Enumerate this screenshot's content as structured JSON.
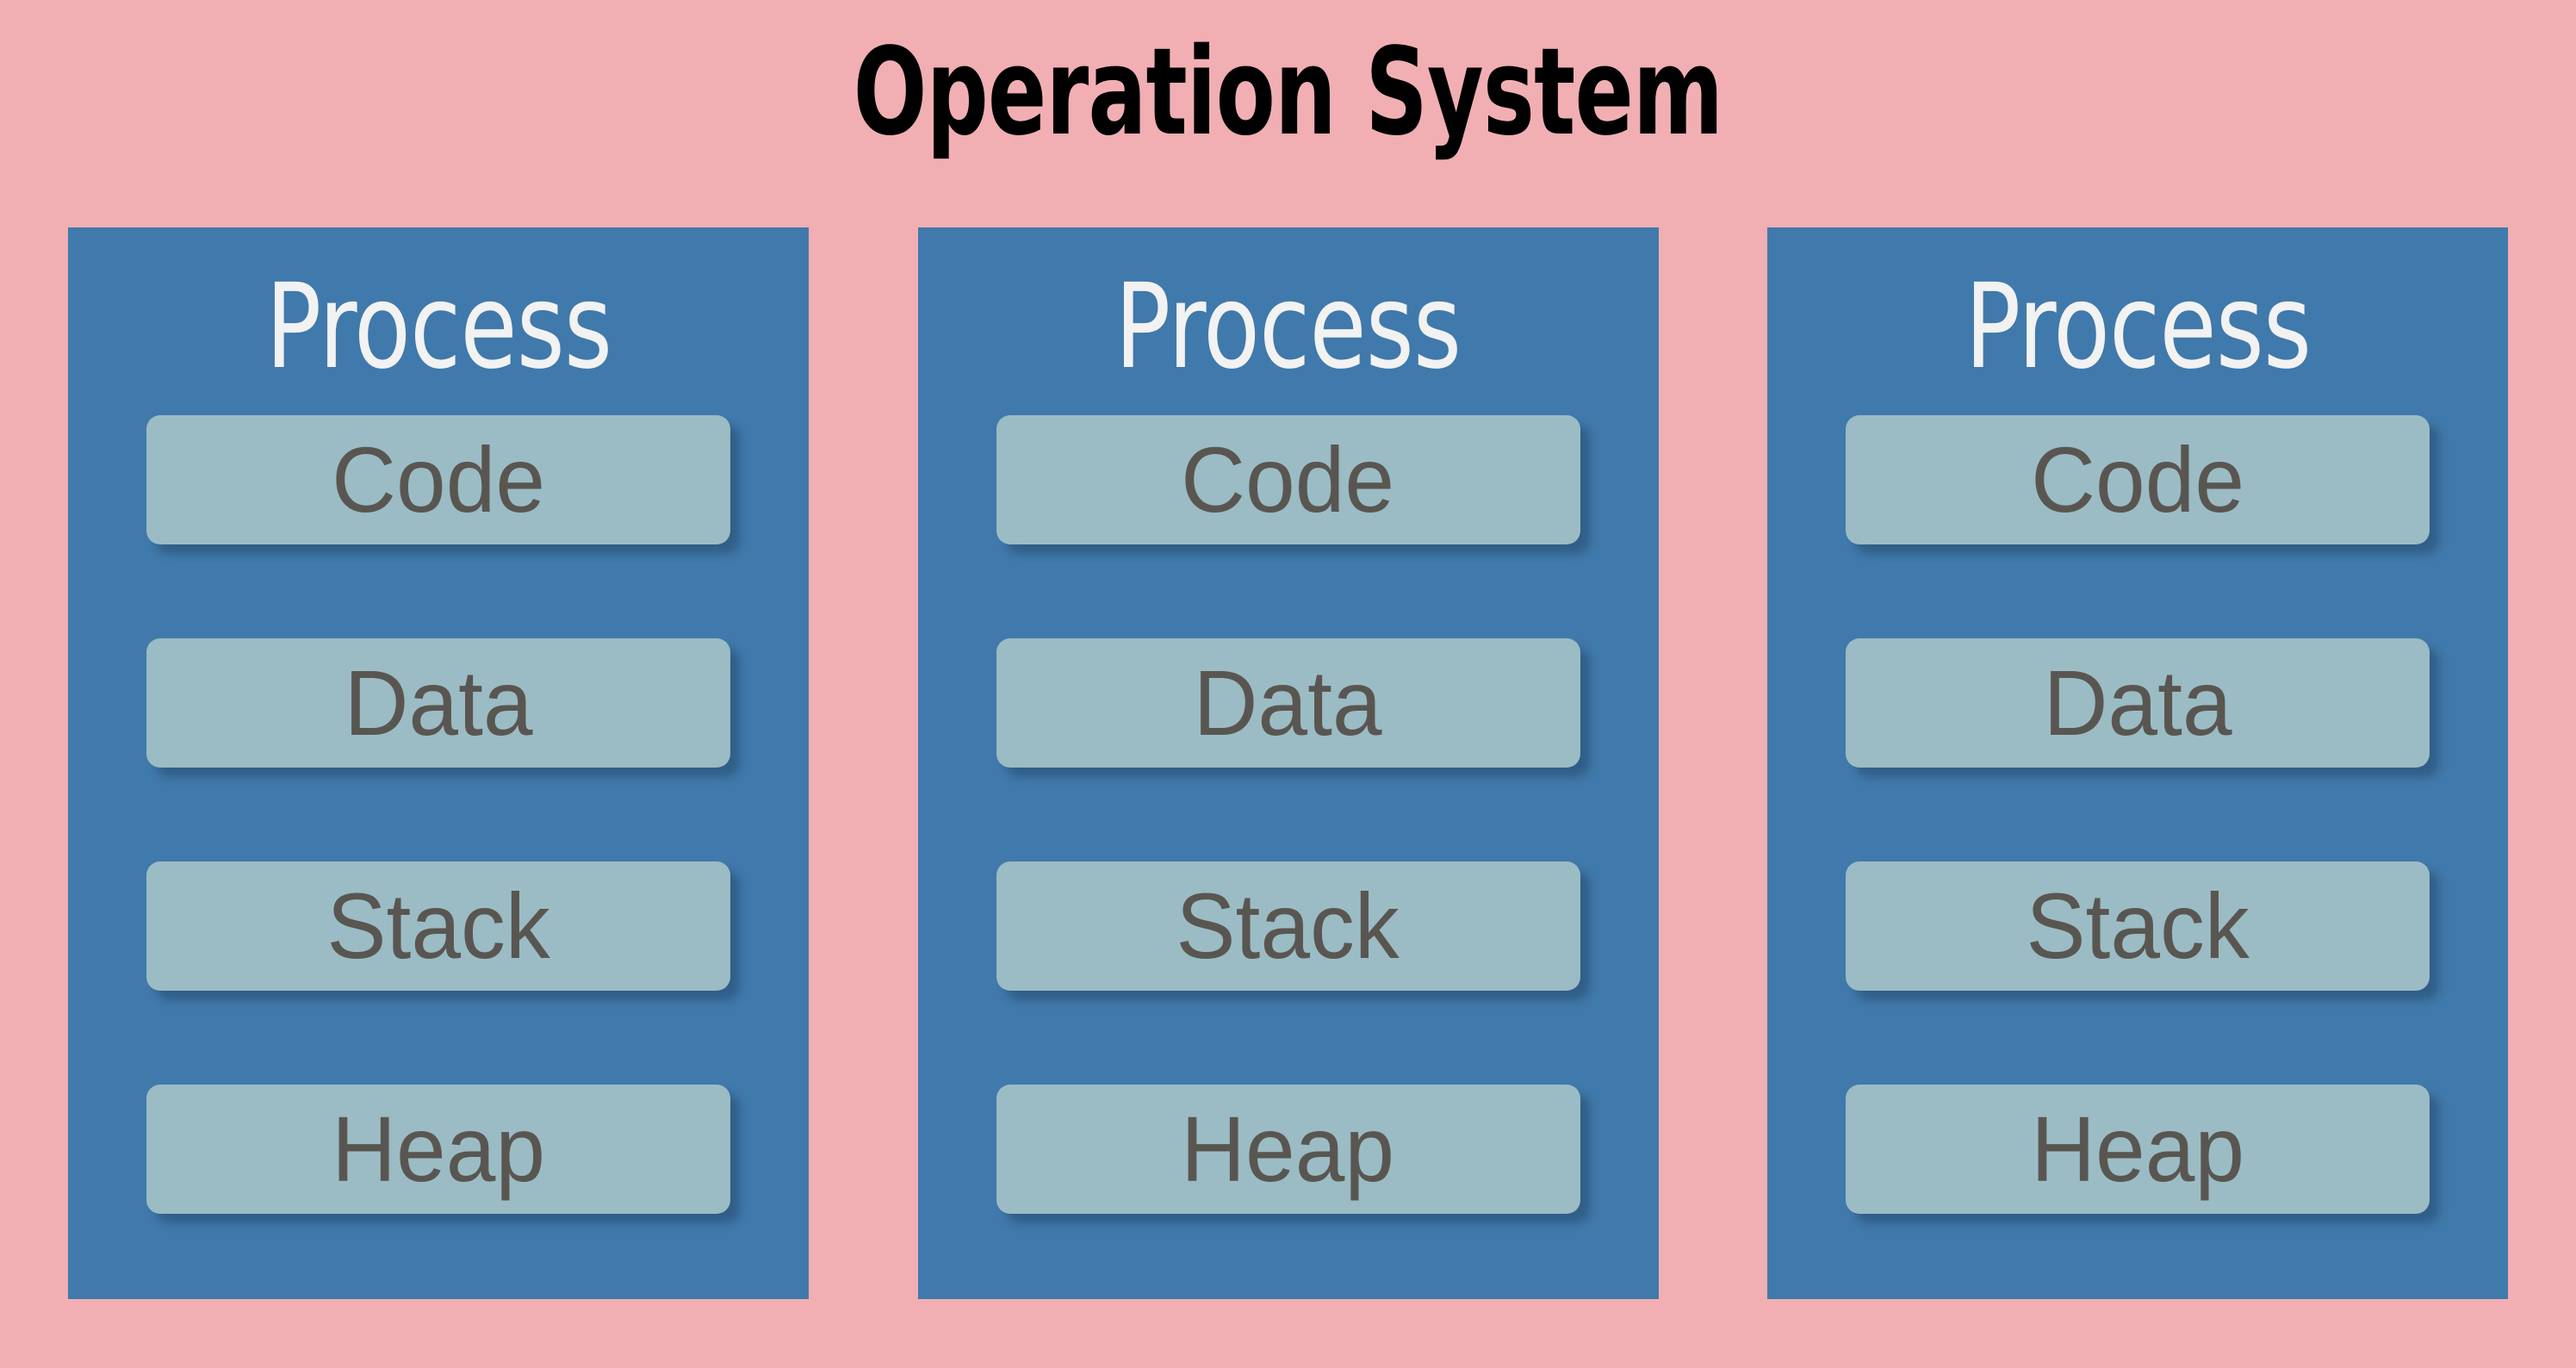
{
  "diagram": {
    "title": "Operation System",
    "background_color": "#F1AFB3",
    "title_color": "#000000",
    "process_box_color": "#4079AB",
    "segment_box_color": "#9BBCC4",
    "segment_text_color": "#595651",
    "process_title_color": "#F2F2F2"
  },
  "processes": [
    {
      "title": "Process",
      "segments": [
        {
          "label": "Code"
        },
        {
          "label": "Data"
        },
        {
          "label": "Stack"
        },
        {
          "label": "Heap"
        }
      ]
    },
    {
      "title": "Process",
      "segments": [
        {
          "label": "Code"
        },
        {
          "label": "Data"
        },
        {
          "label": "Stack"
        },
        {
          "label": "Heap"
        }
      ]
    },
    {
      "title": "Process",
      "segments": [
        {
          "label": "Code"
        },
        {
          "label": "Data"
        },
        {
          "label": "Stack"
        },
        {
          "label": "Heap"
        }
      ]
    }
  ]
}
